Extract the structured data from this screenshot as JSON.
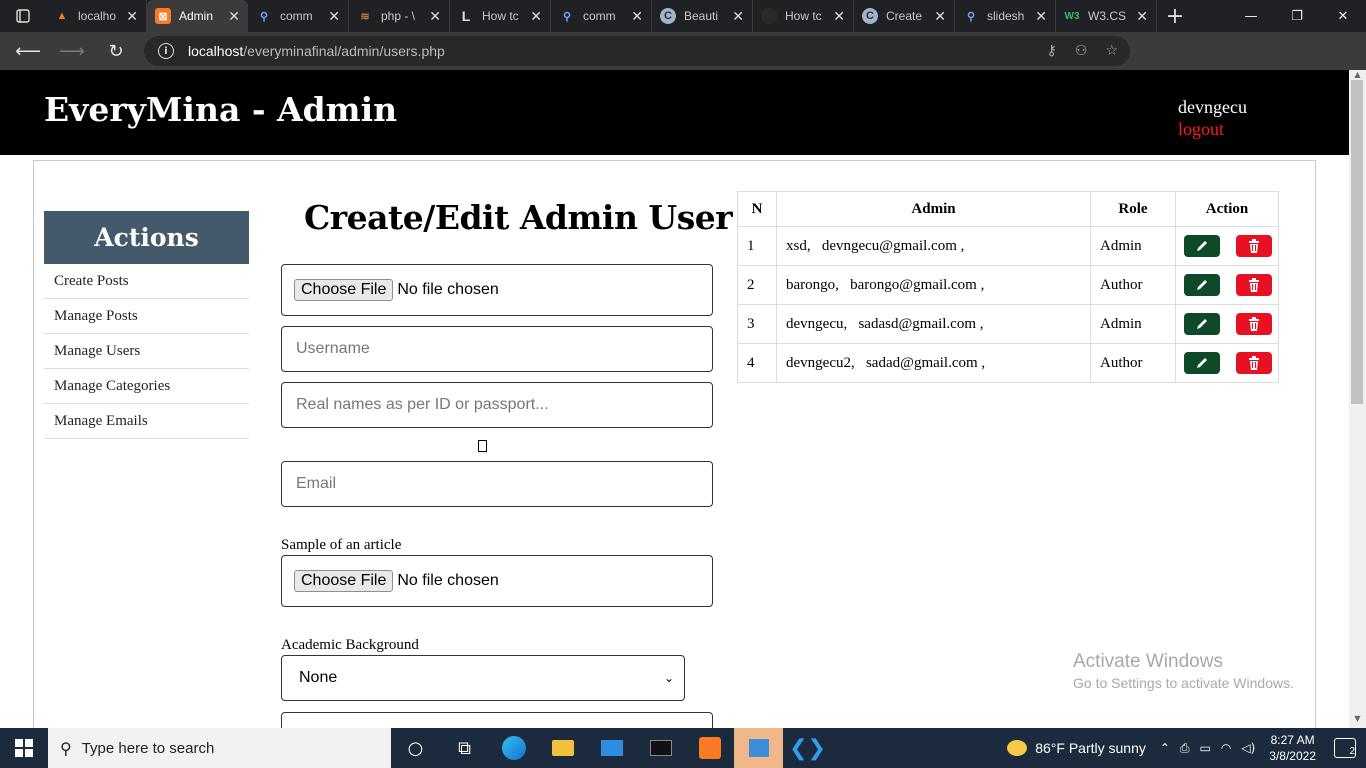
{
  "browser": {
    "tabs": [
      {
        "title": "localho",
        "icon": "xampp-icon",
        "active": false
      },
      {
        "title": "Admin",
        "icon": "xampp-icon",
        "active": true
      },
      {
        "title": "comm",
        "icon": "search-icon",
        "active": false
      },
      {
        "title": "php - \\",
        "icon": "site-icon",
        "active": false
      },
      {
        "title": "How tc",
        "icon": "l-icon",
        "active": false
      },
      {
        "title": "comm",
        "icon": "search-icon",
        "active": false
      },
      {
        "title": "Beauti",
        "icon": "c-icon",
        "active": false
      },
      {
        "title": "How tc",
        "icon": "github-icon",
        "active": false
      },
      {
        "title": "Create",
        "icon": "c-icon",
        "active": false
      },
      {
        "title": "slidesh",
        "icon": "search-icon",
        "active": false
      },
      {
        "title": "W3.CS",
        "icon": "w3-icon",
        "active": false
      }
    ],
    "url_host": "localhost",
    "url_path": "/everyminafinal/admin/users.php"
  },
  "header": {
    "site_title": "EveryMina - Admin",
    "username": "devngecu",
    "logout": "logout"
  },
  "sidebar": {
    "heading": "Actions",
    "items": [
      {
        "label": "Create Posts"
      },
      {
        "label": "Manage Posts"
      },
      {
        "label": "Manage Users"
      },
      {
        "label": "Manage Categories"
      },
      {
        "label": "Manage Emails"
      }
    ]
  },
  "form": {
    "title": "Create/Edit Admin User",
    "choose_file": "Choose File",
    "no_file": "No file chosen",
    "username_placeholder": "Username",
    "realname_placeholder": "Real names as per ID or passport...",
    "email_placeholder": "Email",
    "sample_label": "Sample of an article",
    "academic_label": "Academic Background",
    "academic_value": "None"
  },
  "table": {
    "headers": {
      "n": "N",
      "admin": "Admin",
      "role": "Role",
      "action": "Action"
    },
    "rows": [
      {
        "n": "1",
        "admin": "xsd,   devngecu@gmail.com ,",
        "role": "Admin"
      },
      {
        "n": "2",
        "admin": "barongo,   barongo@gmail.com ,",
        "role": "Author"
      },
      {
        "n": "3",
        "admin": "devngecu,   sadasd@gmail.com ,",
        "role": "Admin"
      },
      {
        "n": "4",
        "admin": "devngecu2,   sadad@gmail.com ,",
        "role": "Author"
      }
    ]
  },
  "watermark": {
    "line1": "Activate Windows",
    "line2": "Go to Settings to activate Windows."
  },
  "taskbar": {
    "search_placeholder": "Type here to search",
    "weather": "86°F  Partly sunny",
    "time": "8:27 AM",
    "date": "3/8/2022",
    "notifications": "2"
  }
}
